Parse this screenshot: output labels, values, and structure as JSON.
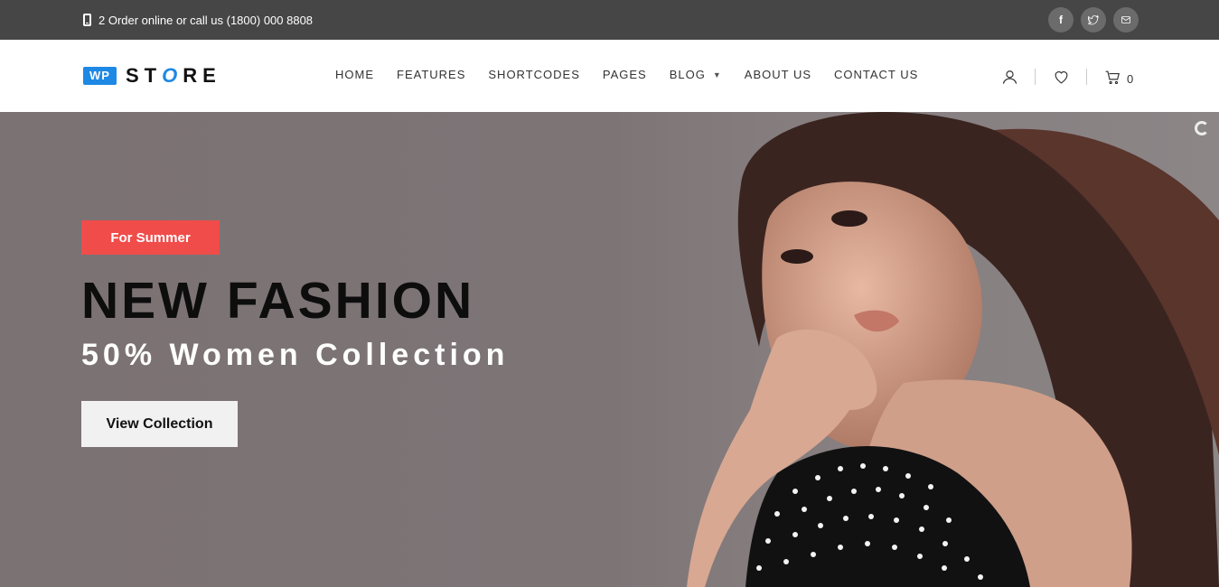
{
  "topbar": {
    "contact_text": "2 Order online or call us (1800) 000 8808",
    "social": [
      {
        "icon": "facebook-icon",
        "glyph": "f"
      },
      {
        "icon": "twitter-icon"
      },
      {
        "icon": "mail-icon"
      }
    ]
  },
  "header": {
    "logo": {
      "badge": "WP",
      "word_start": "ST",
      "word_o": "O",
      "word_end": "RE"
    },
    "nav": [
      {
        "label": "HOME"
      },
      {
        "label": "FEATURES"
      },
      {
        "label": "SHORTCODES"
      },
      {
        "label": "PAGES"
      },
      {
        "label": "BLOG",
        "has_dropdown": true,
        "caret": "▼"
      },
      {
        "label": "ABOUT US"
      },
      {
        "label": "CONTACT US"
      }
    ],
    "cart_count": "0"
  },
  "hero": {
    "badge": "For Summer",
    "headline": "NEW FASHION",
    "subline": "50% Women Collection",
    "cta": "View Collection"
  },
  "colors": {
    "accent_blue": "#1e88e5",
    "badge_red": "#ef4c4a",
    "topbar_bg": "#464646",
    "hero_bg": "#7b7274"
  }
}
